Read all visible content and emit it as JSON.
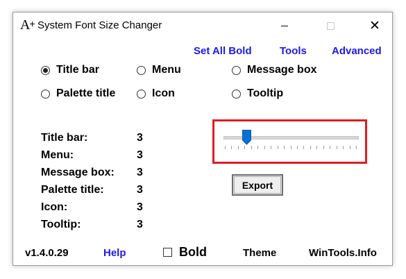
{
  "window": {
    "title": "System Font Size Changer",
    "app_icon": "A",
    "app_icon_plus": "+",
    "close_glyph": "✕"
  },
  "top_links": {
    "set_all_bold": "Set All Bold",
    "tools": "Tools",
    "advanced": "Advanced"
  },
  "radios": [
    {
      "label": "Title bar",
      "checked": true
    },
    {
      "label": "Menu",
      "checked": false
    },
    {
      "label": "Message box",
      "checked": false
    },
    {
      "label": "Palette title",
      "checked": false
    },
    {
      "label": "Icon",
      "checked": false
    },
    {
      "label": "Tooltip",
      "checked": false
    }
  ],
  "values": [
    {
      "label": "Title bar:",
      "value": "3"
    },
    {
      "label": "Menu:",
      "value": "3"
    },
    {
      "label": "Message box:",
      "value": "3"
    },
    {
      "label": "Palette title:",
      "value": "3"
    },
    {
      "label": "Icon:",
      "value": "3"
    },
    {
      "label": "Tooltip:",
      "value": "3"
    }
  ],
  "slider": {
    "value": 3,
    "min": 0,
    "max": 20,
    "tick_count": 21,
    "highlight_color": "#e01c24",
    "thumb_color": "#0a6fd6"
  },
  "export_label": "Export",
  "footer": {
    "version": "v1.4.0.29",
    "help": "Help",
    "bold_label": "Bold",
    "bold_checked": false,
    "theme": "Theme",
    "site": "WinTools.Info"
  },
  "colors": {
    "link": "#1a1ae6"
  }
}
